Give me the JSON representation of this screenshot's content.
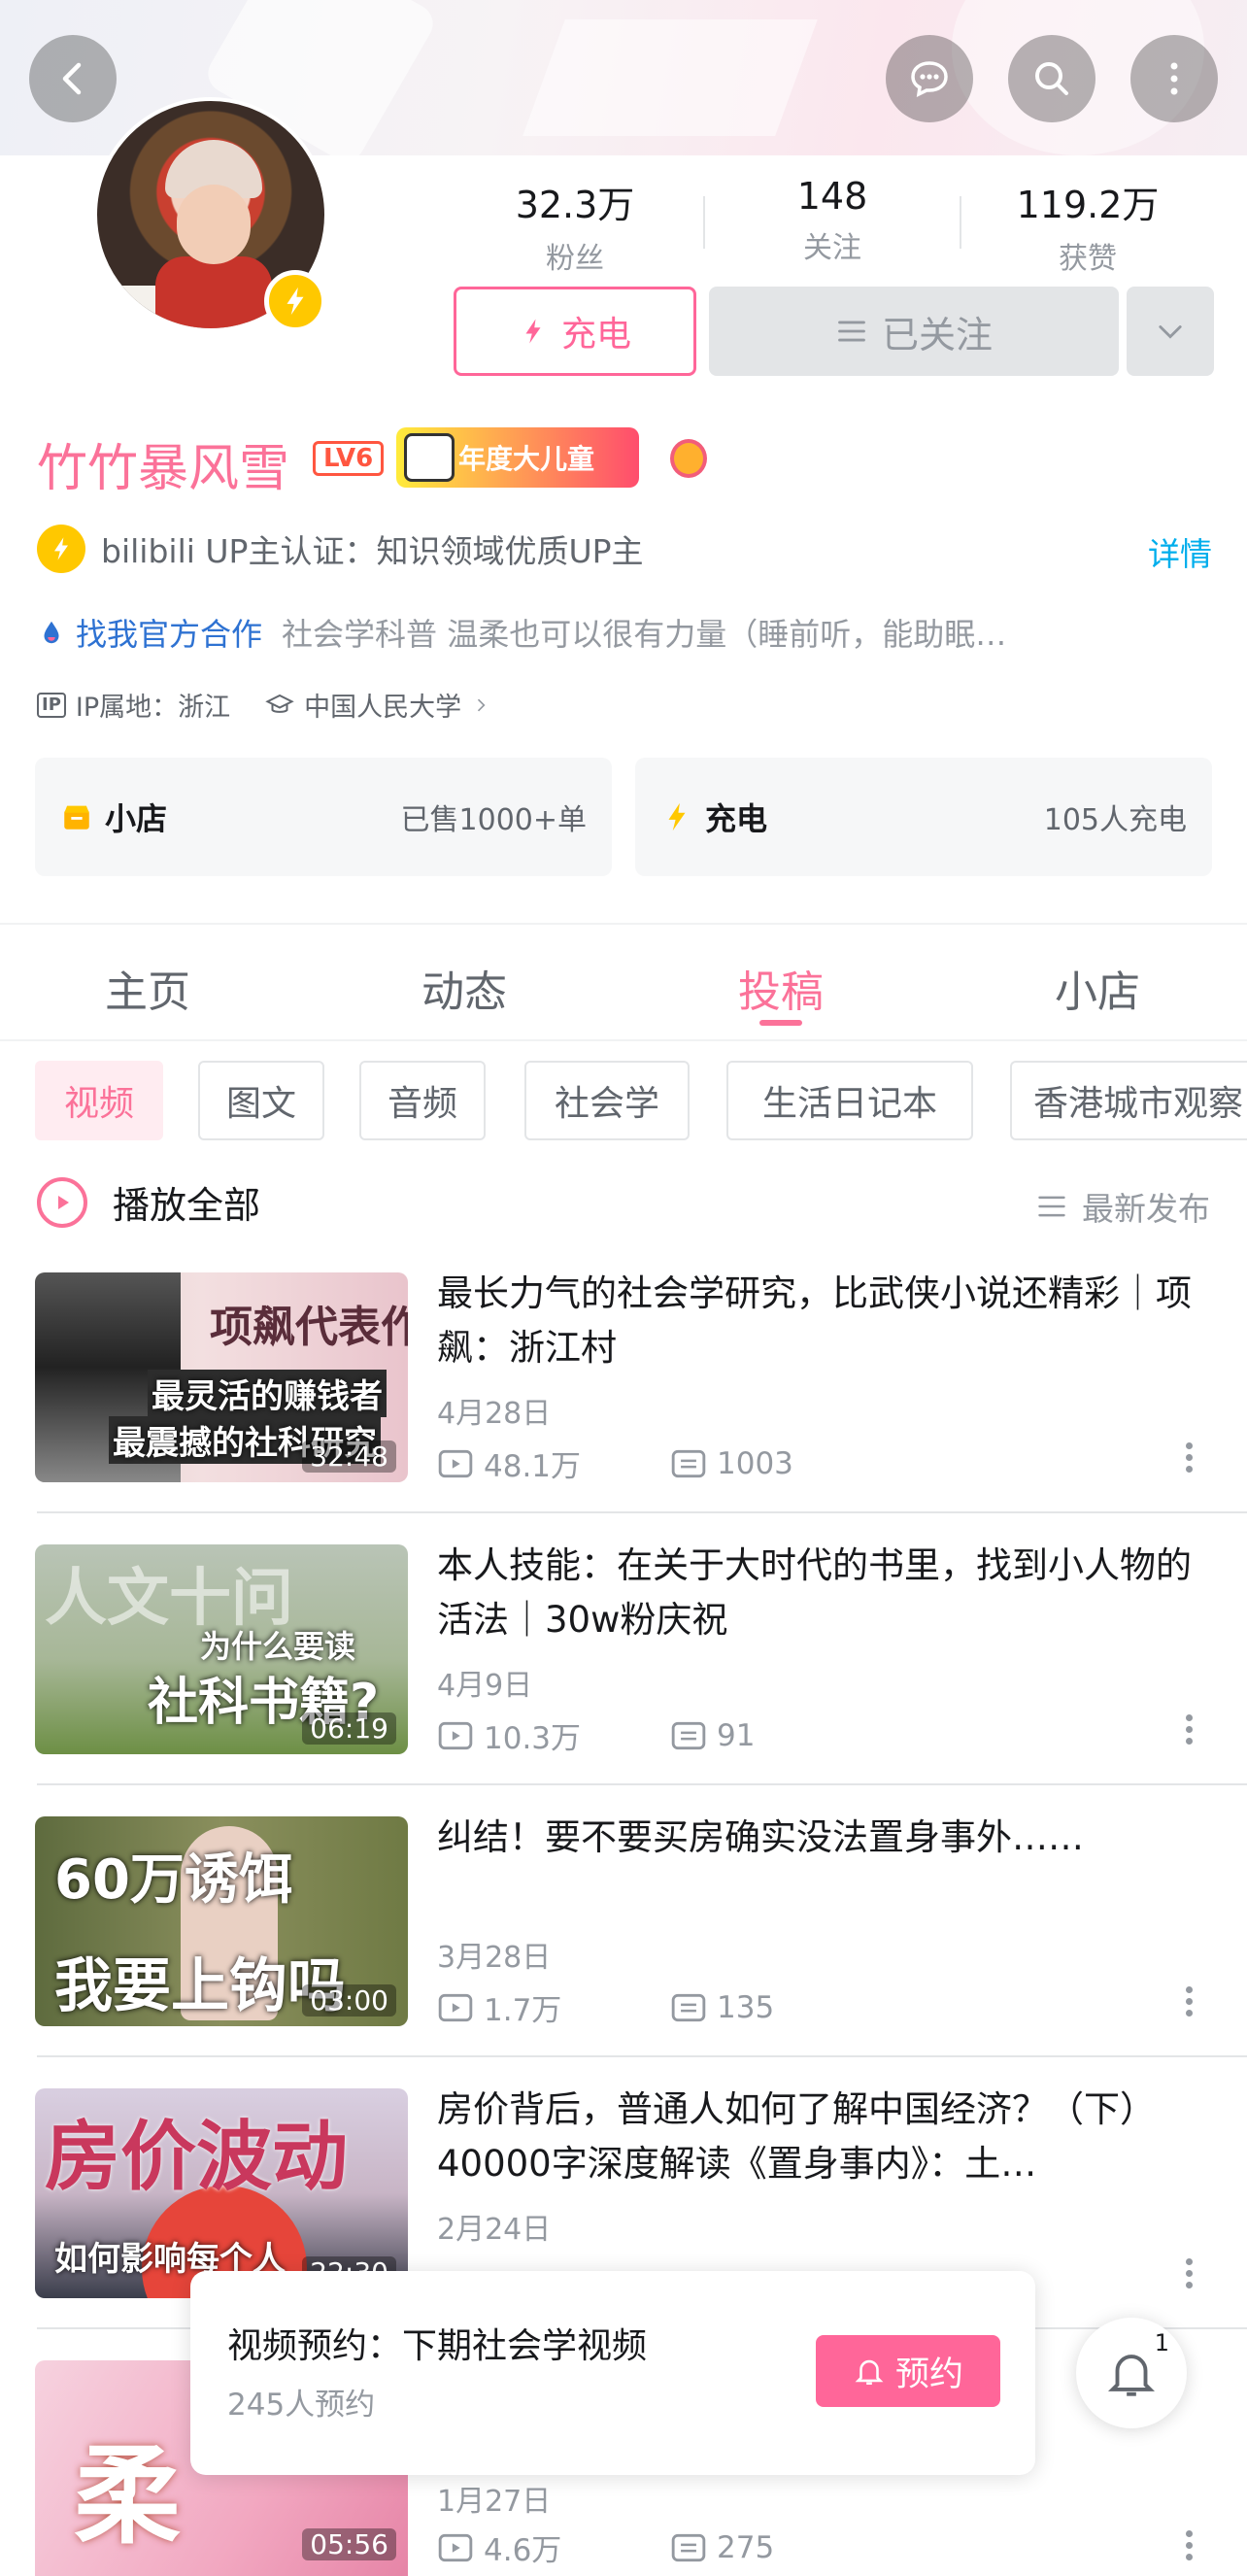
{
  "header": {
    "back_icon": "chevron-left-icon",
    "message_icon": "chat-bubble-icon",
    "search_icon": "search-icon",
    "more_icon": "vertical-dots-icon"
  },
  "profile": {
    "stats": [
      {
        "value": "32.3万",
        "label": "粉丝"
      },
      {
        "value": "148",
        "label": "关注"
      },
      {
        "value": "119.2万",
        "label": "获赞"
      }
    ],
    "charge_button": "充电",
    "follow_button": "已关注",
    "name": "竹竹暴风雪",
    "level": "LV6",
    "medal_text": "年度大儿童",
    "verify_text": "bilibili UP主认证：知识领域优质UP主",
    "detail_link": "详情",
    "coop_link": "找我官方合作",
    "bio": "社会学科普 温柔也可以很有力量（睡前听，能助眠…",
    "ip_tag": "IP",
    "ip_location": "IP属地：浙江",
    "school": "中国人民大学"
  },
  "cards": [
    {
      "title": "小店",
      "meta": "已售1000+单"
    },
    {
      "title": "充电",
      "meta": "105人充电"
    }
  ],
  "tabs": [
    "主页",
    "动态",
    "投稿",
    "小店"
  ],
  "active_tab": "投稿",
  "chips": [
    "视频",
    "图文",
    "音频",
    "社会学",
    "生活日记本",
    "香港城市观察"
  ],
  "play_all": "播放全部",
  "sort_label": "最新发布",
  "videos": [
    {
      "title": "最长力气的社会学研究，比武侠小说还精彩｜项飙：浙江村",
      "date": "4月28日",
      "views": "48.1万",
      "comments": "1003",
      "duration": "32:48",
      "thumb_text": [
        "项飙代表作",
        "最灵活的赚钱者",
        "最震撼的社科研究"
      ]
    },
    {
      "title": "本人技能：在关于大时代的书里，找到小人物的活法｜30w粉庆祝",
      "date": "4月9日",
      "views": "10.3万",
      "comments": "91",
      "duration": "06:19",
      "thumb_text": [
        "人文十问",
        "为什么要读",
        "社科书籍?"
      ]
    },
    {
      "title": "纠结！要不要买房确实没法置身事外……",
      "date": "3月28日",
      "views": "1.7万",
      "comments": "135",
      "duration": "03:00",
      "thumb_text": [
        "60万诱饵",
        "我要上钩吗"
      ]
    },
    {
      "title": "房价背后，普通人如何了解中国经济？（下）40000字深度解读《置身事内》：土…",
      "date": "2月24日",
      "views": "",
      "comments": "",
      "duration": "22:30",
      "thumb_text": [
        "房价波动",
        "如何影响每个人"
      ]
    },
    {
      "title": "",
      "date": "1月27日",
      "views": "4.6万",
      "comments": "275",
      "duration": "05:56",
      "thumb_text": [
        "柔"
      ]
    }
  ],
  "reservation": {
    "title": "视频预约：下期社会学视频",
    "count": "245人预约",
    "button": "预约"
  },
  "notifications": {
    "count": "1"
  },
  "colors": {
    "accent": "#fb7299",
    "link": "#00aeec",
    "bolt": "#ffc800"
  }
}
